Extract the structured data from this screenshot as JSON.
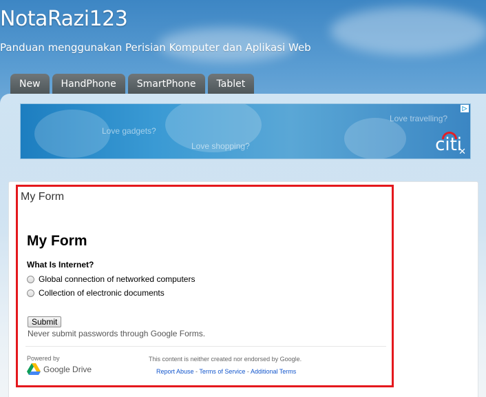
{
  "blog": {
    "title": "NotaRazi123",
    "description": "Panduan menggunakan Perisian Komputer dan Aplikasi Web"
  },
  "tabs": [
    {
      "label": "New"
    },
    {
      "label": "HandPhone"
    },
    {
      "label": "SmartPhone"
    },
    {
      "label": "Tablet"
    }
  ],
  "ad": {
    "text_1": "Love gadgets?",
    "text_2": "Love shopping?",
    "text_3": "Love travelling?",
    "logo": "citi",
    "choices_icon": "ad-choices-icon"
  },
  "gadget": {
    "title": "My Form"
  },
  "form": {
    "heading": "My Form",
    "question": "What Is Internet?",
    "options": [
      {
        "label": "Global connection of networked computers"
      },
      {
        "label": "Collection of electronic documents"
      }
    ],
    "submit_label": "Submit",
    "warning": "Never submit passwords through Google Forms.",
    "powered_by": "Powered by",
    "drive_logo_text": "Google Drive",
    "disclaimer": "This content is neither created nor endorsed by Google.",
    "links": {
      "report_abuse": "Report Abuse",
      "sep1": " - ",
      "terms": "Terms of Service",
      "sep2": " - ",
      "additional": "Additional Terms"
    }
  },
  "colors": {
    "accent_blue": "#3d86c4",
    "tab_bg": "#5a6265",
    "highlight_red": "#e4181d",
    "link_blue": "#1155cc"
  }
}
